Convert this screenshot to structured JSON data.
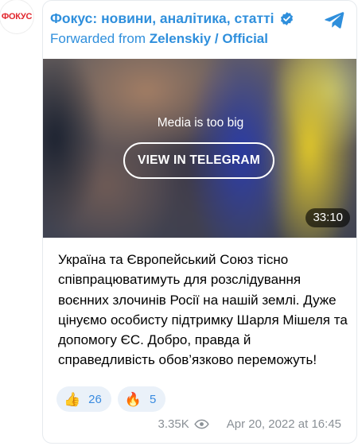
{
  "channel": {
    "avatar_text": "ФОКУС",
    "name": "Фокус: новини, аналітика, статті",
    "forwarded_prefix": "Forwarded from ",
    "forwarded_source": "Zelenskiy / Official"
  },
  "media": {
    "notice": "Media is too big",
    "button_label": "VIEW IN TELEGRAM",
    "duration": "33:10"
  },
  "post": {
    "text": "Україна та Європейський Союз тісно співпрацюватимуть для розслідування воєнних злочинів Росії на нашій землі. Дуже цінуємо особисту підтримку Шарля Мішеля та допомогу ЄС. Добро, правда й справедливість обов’язково переможуть!"
  },
  "reactions": [
    {
      "emoji": "👍",
      "count": "26"
    },
    {
      "emoji": "🔥",
      "count": "5"
    }
  ],
  "footer": {
    "views": "3.35K",
    "date": "Apr 20, 2022 at 16:45"
  },
  "colors": {
    "accent": "#2f8fdc",
    "brand": "#e1262d",
    "reaction_bg": "#eaf1f9",
    "meta": "#8a9096"
  },
  "icons": {
    "verified": "verified-badge-icon",
    "telegram": "telegram-logo-icon",
    "views": "eye-icon"
  }
}
